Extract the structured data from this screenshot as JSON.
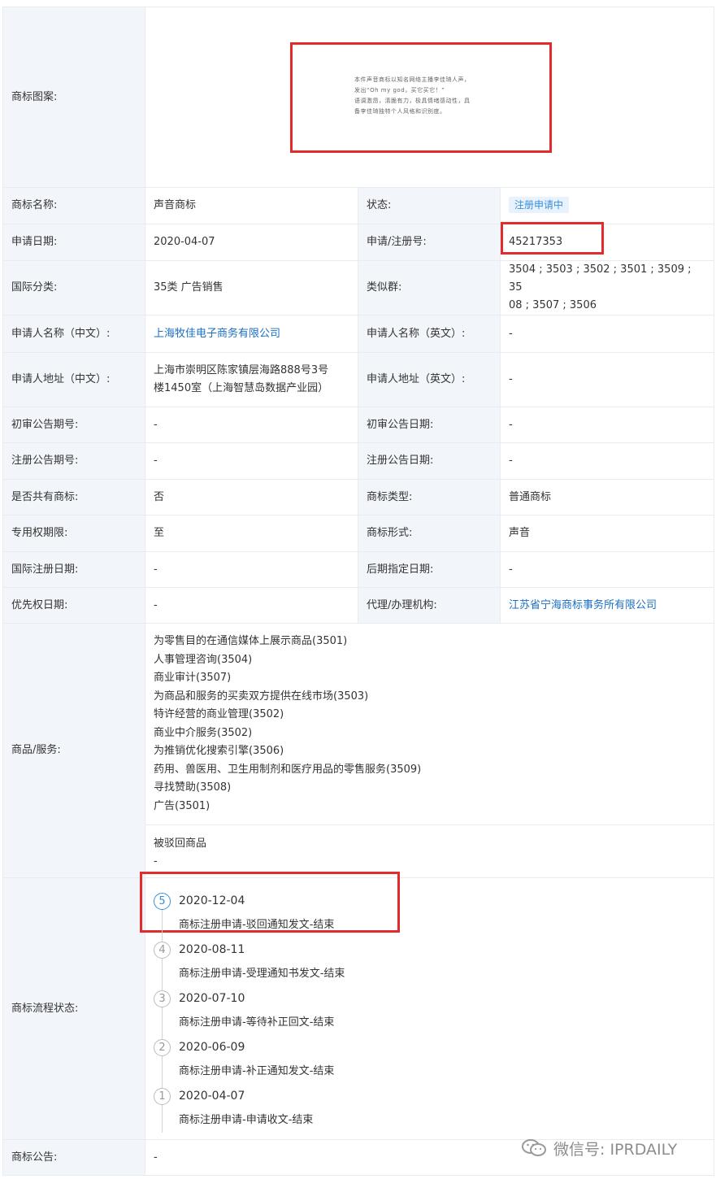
{
  "rows": {
    "pattern": {
      "label": "商标图案:"
    },
    "name": {
      "label": "商标名称:",
      "value": "声音商标"
    },
    "status": {
      "label": "状态:",
      "value": "注册申请中"
    },
    "apply_date": {
      "label": "申请日期:",
      "value": "2020-04-07"
    },
    "reg_no": {
      "label": "申请/注册号:",
      "value": "45217353"
    },
    "intl_class": {
      "label": "国际分类:",
      "value": "35类 广告销售"
    },
    "similar_group": {
      "label": "类似群:",
      "value": "3504 ; 3503 ; 3502 ; 3501 ; 3509 ; 35",
      "value2": "08 ; 3507 ; 3506"
    },
    "applicant_cn": {
      "label": "申请人名称（中文）:",
      "value": "上海牧佳电子商务有限公司"
    },
    "applicant_en": {
      "label": "申请人名称（英文）:",
      "value": "-"
    },
    "address_cn": {
      "label": "申请人地址（中文）:",
      "value": "上海市崇明区陈家镇层海路888号3号",
      "value2": "楼1450室（上海智慧岛数据产业园）"
    },
    "address_en": {
      "label": "申请人地址（英文）:",
      "value": "-"
    },
    "prelim_no": {
      "label": "初审公告期号:",
      "value": "-"
    },
    "prelim_date": {
      "label": "初审公告日期:",
      "value": "-"
    },
    "reg_pub_no": {
      "label": "注册公告期号:",
      "value": "-"
    },
    "reg_pub_date": {
      "label": "注册公告日期:",
      "value": "-"
    },
    "shared": {
      "label": "是否共有商标:",
      "value": "否"
    },
    "tm_type": {
      "label": "商标类型:",
      "value": "普通商标"
    },
    "exclusive": {
      "label": "专用权期限:",
      "value": "至"
    },
    "tm_form": {
      "label": "商标形式:",
      "value": "声音"
    },
    "intl_reg_date": {
      "label": "国际注册日期:",
      "value": "-"
    },
    "later_date": {
      "label": "后期指定日期:",
      "value": "-"
    },
    "priority_date": {
      "label": "优先权日期:",
      "value": "-"
    },
    "agent": {
      "label": "代理/办理机构:",
      "value": "江苏省宁海商标事务所有限公司"
    },
    "goods": {
      "label": "商品/服务:",
      "items": [
        "为零售目的在通信媒体上展示商品(3501)",
        "人事管理咨询(3504)",
        "商业审计(3507)",
        "为商品和服务的买卖双方提供在线市场(3503)",
        "特许经营的商业管理(3502)",
        "商业中介服务(3502)",
        "为推销优化搜索引擎(3506)",
        "药用、兽医用、卫生用制剂和医疗用品的零售服务(3509)",
        "寻找赞助(3508)",
        "广告(3501)"
      ],
      "rejected_title": "被驳回商品",
      "rejected_value": "-"
    },
    "flow": {
      "label": "商标流程状态:",
      "steps": [
        {
          "num": "5",
          "date": "2020-12-04",
          "desc": "商标注册申请-驳回通知发文-结束"
        },
        {
          "num": "4",
          "date": "2020-08-11",
          "desc": "商标注册申请-受理通知书发文-结束"
        },
        {
          "num": "3",
          "date": "2020-07-10",
          "desc": "商标注册申请-等待补正回文-结束"
        },
        {
          "num": "2",
          "date": "2020-06-09",
          "desc": "商标注册申请-补正通知发文-结束"
        },
        {
          "num": "1",
          "date": "2020-04-07",
          "desc": "商标注册申请-申请收文-结束"
        }
      ]
    },
    "announcement": {
      "label": "商标公告:",
      "value": "-"
    }
  },
  "pattern_text": {
    "line1": "本件声音商标以知名网络主播李佳琦人声，",
    "line2": "发出“Oh my god，买它买它！”",
    "line3": "语调激昂，清脆有力，极具情绪感动性，具",
    "line4": "备李佳琦独特个人风格和识别度。"
  },
  "watermark": {
    "text": "微信号: IPRDAILY"
  },
  "colors": {
    "label_bg": "#f2f6fb",
    "border": "#e8ecf2",
    "link": "#1a6fc2",
    "badge_bg": "#e8f2fc",
    "badge_text": "#3b8fd9",
    "highlight": "#e32b2b"
  }
}
